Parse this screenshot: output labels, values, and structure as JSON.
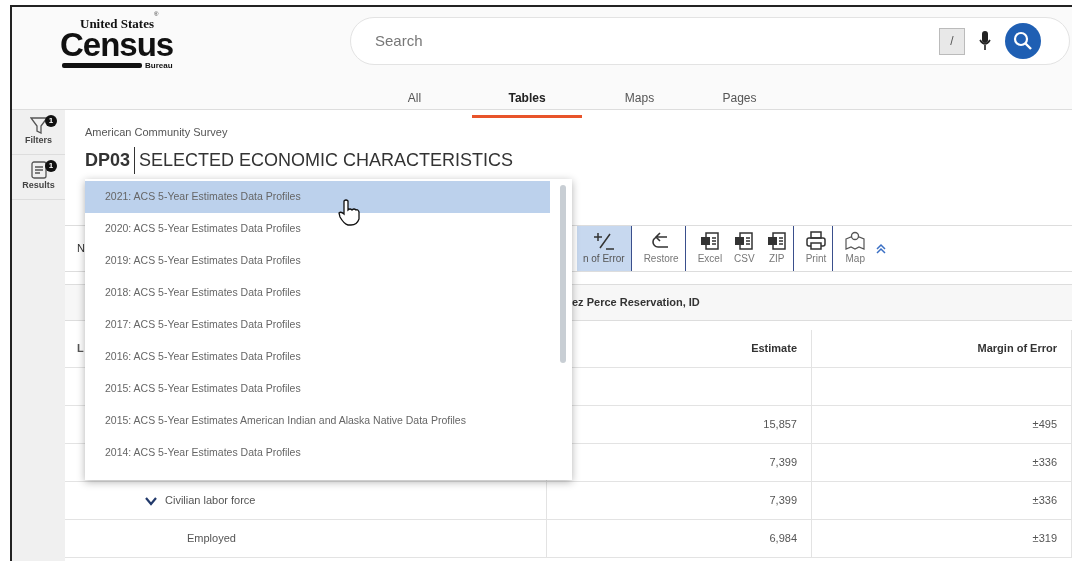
{
  "logo": {
    "line1": "United States",
    "mark": "®",
    "line2": "Census",
    "line3": "Bureau"
  },
  "search": {
    "placeholder": "Search",
    "shortcut": "/"
  },
  "tabs": [
    {
      "label": "All",
      "selected": false
    },
    {
      "label": "Tables",
      "selected": true
    },
    {
      "label": "Maps",
      "selected": false
    },
    {
      "label": "Pages",
      "selected": false
    }
  ],
  "sidebar": {
    "items": [
      {
        "label": "Filters",
        "kind": "filter",
        "count": "1"
      },
      {
        "label": "Results",
        "kind": "results",
        "count": "1"
      }
    ]
  },
  "survey": "American Community Survey",
  "table_id": "DP03",
  "table_title": "SELECTED ECONOMIC CHARACTERISTICS",
  "dropdown": {
    "items": [
      {
        "label": "2021: ACS 5-Year Estimates Data Profiles",
        "selected": true
      },
      {
        "label": "2020: ACS 5-Year Estimates Data Profiles",
        "selected": false
      },
      {
        "label": "2019: ACS 5-Year Estimates Data Profiles",
        "selected": false
      },
      {
        "label": "2018: ACS 5-Year Estimates Data Profiles",
        "selected": false
      },
      {
        "label": "2017: ACS 5-Year Estimates Data Profiles",
        "selected": false
      },
      {
        "label": "2016: ACS 5-Year Estimates Data Profiles",
        "selected": false
      },
      {
        "label": "2015: ACS 5-Year Estimates Data Profiles",
        "selected": false
      },
      {
        "label": "2015: ACS 5-Year Estimates American Indian and Alaska Native Data Profiles",
        "selected": false
      },
      {
        "label": "2014: ACS 5-Year Estimates Data Profiles",
        "selected": false
      }
    ]
  },
  "toolbar": {
    "partial_text": "N",
    "buttons": [
      {
        "label": "n of Error",
        "kind": "margin",
        "selected": true,
        "group_end": true
      },
      {
        "label": "Restore",
        "kind": "restore",
        "selected": false,
        "group_end": true
      },
      {
        "label": "Excel",
        "kind": "excel",
        "selected": false,
        "group_end": false
      },
      {
        "label": "CSV",
        "kind": "csv",
        "selected": false,
        "group_end": false
      },
      {
        "label": "ZIP",
        "kind": "zip",
        "selected": false,
        "group_end": true
      },
      {
        "label": "Print",
        "kind": "print",
        "selected": false,
        "group_end": true
      },
      {
        "label": "Map",
        "kind": "map",
        "selected": false,
        "group_end": false
      }
    ]
  },
  "table": {
    "geography": "ez Perce Reservation, ID",
    "columns": [
      "L",
      "Estimate",
      "Margin of Error"
    ],
    "rows": [
      {},
      {
        "estimate": "15,857",
        "moe": "±495"
      },
      {
        "estimate": "7,399",
        "moe": "±336"
      },
      {
        "label": "Civilian labor force",
        "estimate": "7,399",
        "moe": "±336",
        "expanded": true,
        "children": [
          {
            "label": "Employed",
            "estimate": "6,984",
            "moe": "±319"
          }
        ]
      }
    ]
  }
}
